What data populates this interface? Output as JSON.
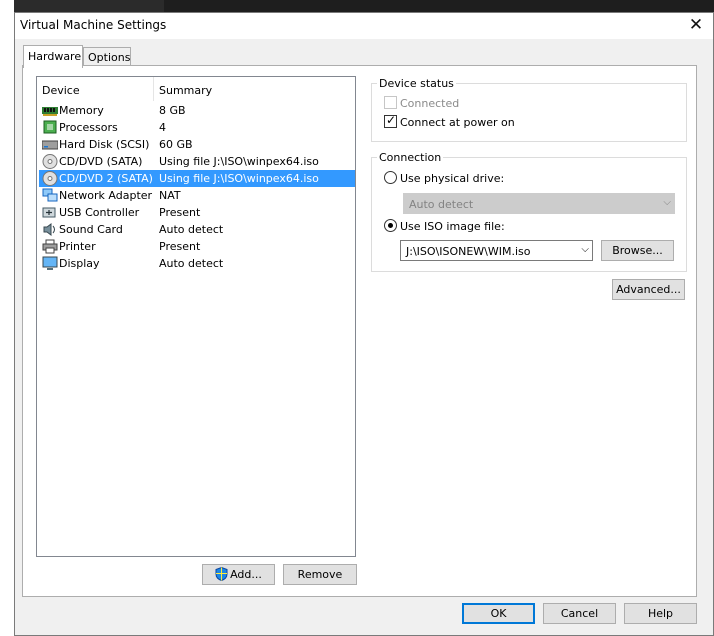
{
  "window": {
    "title": "Virtual Machine Settings",
    "close_glyph": "✕"
  },
  "tabs": [
    {
      "label": "Hardware",
      "active": true
    },
    {
      "label": "Options",
      "active": false
    }
  ],
  "device_list": {
    "columns": {
      "device": "Device",
      "summary": "Summary"
    },
    "selected_index": 4,
    "rows": [
      {
        "name": "Memory",
        "summary": "8 GB",
        "icon": "memory-icon"
      },
      {
        "name": "Processors",
        "summary": "4",
        "icon": "processor-icon"
      },
      {
        "name": "Hard Disk (SCSI)",
        "summary": "60 GB",
        "icon": "hard-disk-icon"
      },
      {
        "name": "CD/DVD (SATA)",
        "summary": "Using file J:\\ISO\\winpex64.iso",
        "icon": "cd-dvd-icon"
      },
      {
        "name": "CD/DVD 2 (SATA)",
        "summary": "Using file J:\\ISO\\winpex64.iso",
        "icon": "cd-dvd-icon"
      },
      {
        "name": "Network Adapter",
        "summary": "NAT",
        "icon": "network-adapter-icon"
      },
      {
        "name": "USB Controller",
        "summary": "Present",
        "icon": "usb-icon"
      },
      {
        "name": "Sound Card",
        "summary": "Auto detect",
        "icon": "sound-card-icon"
      },
      {
        "name": "Printer",
        "summary": "Present",
        "icon": "printer-icon"
      },
      {
        "name": "Display",
        "summary": "Auto detect",
        "icon": "display-icon"
      }
    ]
  },
  "list_buttons": {
    "add": "Add...",
    "remove": "Remove"
  },
  "device_status": {
    "label": "Device status",
    "connected": {
      "label": "Connected",
      "checked": false,
      "enabled": false
    },
    "connect_at_power_on": {
      "label": "Connect at power on",
      "checked": true,
      "enabled": true
    }
  },
  "connection": {
    "label": "Connection",
    "physical_drive": {
      "label": "Use physical drive:",
      "selected": false
    },
    "physical_drive_value": "Auto detect",
    "iso_image": {
      "label": "Use ISO image file:",
      "selected": true
    },
    "iso_path": "J:\\ISO\\ISONEW\\WIM.iso",
    "browse_label": "Browse..."
  },
  "advanced_label": "Advanced...",
  "footer": {
    "ok": "OK",
    "cancel": "Cancel",
    "help": "Help"
  },
  "colors": {
    "selection": "#3399ff",
    "default_button_border": "#0078d7"
  }
}
